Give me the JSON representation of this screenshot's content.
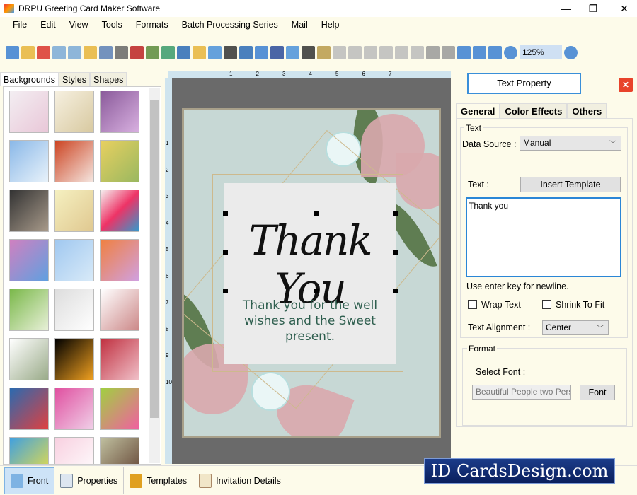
{
  "window": {
    "title": "DRPU Greeting Card Maker Software",
    "minimize": "—",
    "maximize": "❐",
    "close": "✕"
  },
  "menu": [
    "File",
    "Edit",
    "View",
    "Tools",
    "Formats",
    "Batch Processing Series",
    "Mail",
    "Help"
  ],
  "toolbar": {
    "zoom_value": "125%",
    "icons": [
      "new-icon",
      "open-icon",
      "close-doc-icon",
      "save-icon",
      "save-as-icon",
      "export-icon",
      "print-preview-icon",
      "print-icon",
      "copy-layers-icon",
      "background-icon",
      "image-icon",
      "pen-icon",
      "shapes-icon",
      "watermark-icon",
      "barcode-icon",
      "text-icon",
      "word-art-icon",
      "signature-icon",
      "email-icon",
      "line-icon",
      "database-icon",
      "undo-icon",
      "redo-icon",
      "cut-icon",
      "copy-icon",
      "paste-icon",
      "delete-icon",
      "bring-front-icon",
      "send-back-icon",
      "grid-icon",
      "actual-size-icon",
      "fit-icon",
      "zoom-in-icon",
      "zoom-out-icon"
    ]
  },
  "left_tabs": [
    "Backgrounds",
    "Styles",
    "Shapes"
  ],
  "ruler": {
    "h_marks": [
      "1",
      "2",
      "3",
      "4",
      "5",
      "6",
      "7"
    ],
    "v_marks": [
      "1",
      "2",
      "3",
      "4",
      "5",
      "6",
      "7",
      "8",
      "9",
      "10"
    ]
  },
  "card": {
    "title": "Thank You",
    "message": "Thank you for the well wishes and the Sweet present.",
    "colors": {
      "background": "#c7d8d5",
      "petal": "#d9a9ad",
      "leaf": "#5f7d52",
      "text": "#2f5f4f"
    }
  },
  "panel": {
    "title": "Text Property",
    "tabs": [
      "General",
      "Color Effects",
      "Others"
    ],
    "text_group": "Text",
    "data_source_label": "Data Source :",
    "data_source_value": "Manual",
    "text_label": "Text :",
    "insert_template": "Insert Template",
    "text_value": "Thank you",
    "hint": "Use enter key for newline.",
    "wrap_text": {
      "label": "Wrap Text",
      "checked": false
    },
    "shrink_to_fit": {
      "label": "Shrink To Fit",
      "checked": false
    },
    "alignment_label": "Text Alignment :",
    "alignment_value": "Center",
    "format_group": "Format",
    "select_font_label": "Select Font :",
    "font_value": "Beautiful People two Person",
    "font_button": "Font"
  },
  "bottom_tabs": [
    "Front",
    "Properties",
    "Templates",
    "Invitation Details"
  ],
  "brand": "ID CardsDesign.com"
}
